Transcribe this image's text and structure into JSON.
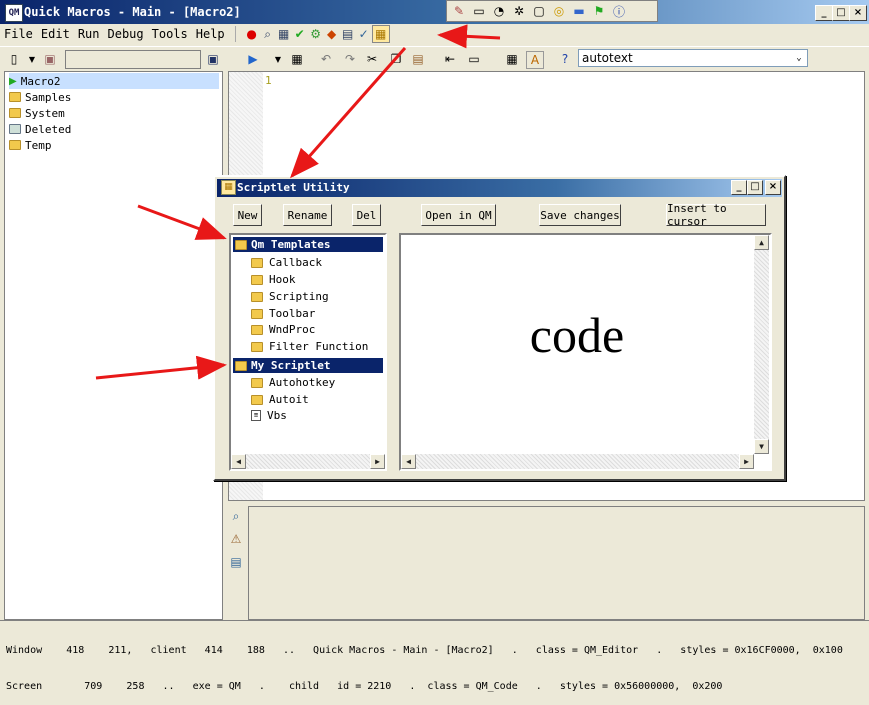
{
  "app": {
    "title": "Quick Macros - Main - [Macro2]",
    "icon_label": "QM"
  },
  "menu": [
    "File",
    "Edit",
    "Run",
    "Debug",
    "Tools",
    "Help"
  ],
  "toolbar": {
    "macro_combo_value": "",
    "autotext_value": "autotext"
  },
  "tree": [
    {
      "label": "Macro2",
      "icon": "macro-play-icon",
      "selected": true
    },
    {
      "label": "Samples",
      "icon": "folder-shared-icon"
    },
    {
      "label": "System",
      "icon": "folder-system-icon"
    },
    {
      "label": "Deleted",
      "icon": "recycle-folder-icon"
    },
    {
      "label": "Temp",
      "icon": "folder-system-icon"
    }
  ],
  "editor": {
    "line_number": "1"
  },
  "status": {
    "line1": "Window    418    211,   client   414    188   ..   Quick Macros - Main - [Macro2]   .   class = QM_Editor   .   styles = 0x16CF0000,  0x100",
    "line2": "Screen       709    258   ..   exe = QM   .    child   id = 2210   .  class = QM_Code   .   styles = 0x56000000,  0x200"
  },
  "dialog": {
    "title": "Scriptlet Utility",
    "buttons": {
      "new": "New",
      "rename": "Rename",
      "del": "Del",
      "open_in_qm": "Open in QM",
      "save_changes": "Save changes",
      "insert_to_cursor": "Insert to cursor"
    },
    "groups": [
      {
        "label": "Qm Templates",
        "items": [
          "Callback",
          "Hook",
          "Scripting",
          "Toolbar",
          "WndProc",
          "Filter Function"
        ]
      },
      {
        "label": "My Scriptlet",
        "items": [
          "Autohotkey",
          "Autoit",
          "Vbs"
        ]
      }
    ],
    "code_text": "code"
  },
  "colors": {
    "titlebar": "#0A246A",
    "accent": "#E81818",
    "face": "#ECE9D8"
  }
}
